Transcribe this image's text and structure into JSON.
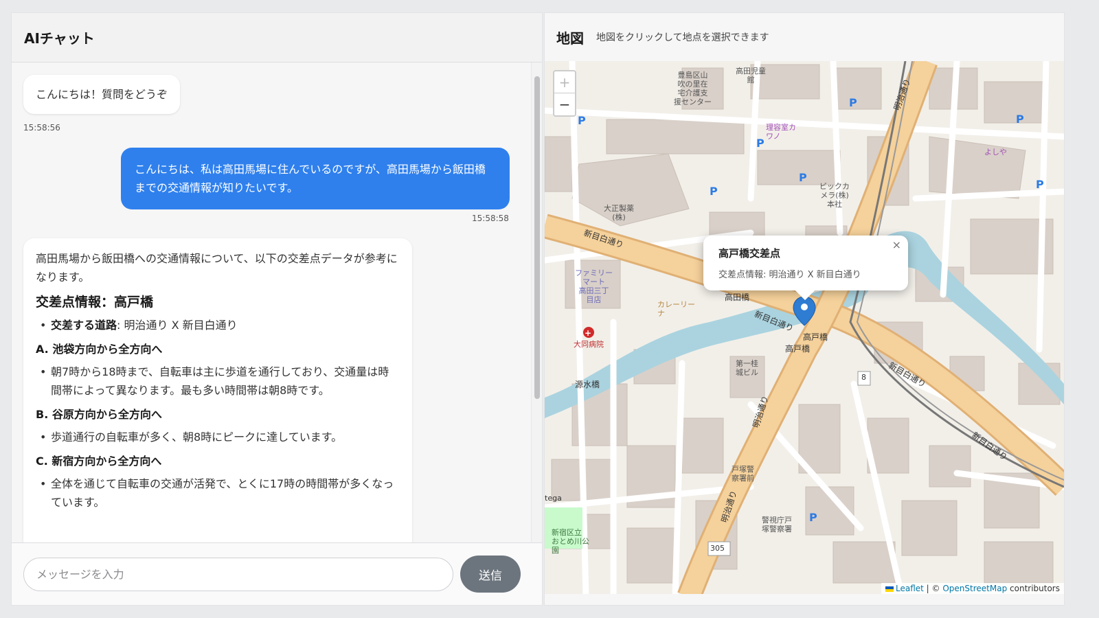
{
  "chat": {
    "title": "AIチャット",
    "messages": [
      {
        "role": "ai",
        "text": "こんにちは！質問をどうぞ",
        "time": "15:58:56"
      },
      {
        "role": "user",
        "text": "こんにちは、私は高田馬場に住んでいるのですが、高田馬場から飯田橋までの交通情報が知りたいです。",
        "time": "15:58:58"
      },
      {
        "role": "ai",
        "intro": "高田馬場から飯田橋への交通情報について、以下の交差点データが参考になります。",
        "heading": "交差点情報：高戸橋",
        "road_label": "交差する道路",
        "road_value": ": 明治通り X 新目白通り",
        "sections": [
          {
            "title": "A. 池袋方向から全方向へ",
            "text": "朝7時から18時まで、自転車は主に歩道を通行しており、交通量は時間帯によって異なります。最も多い時間帯は朝8時です。"
          },
          {
            "title": "B. 谷原方向から全方向へ",
            "text": "歩道通行の自転車が多く、朝8時にピークに達しています。"
          },
          {
            "title": "C. 新宿方向から全方向へ",
            "text": "全体を通じて自転車の交通が活発で、とくに17時の時間帯が多くなっています。"
          }
        ]
      }
    ],
    "input_placeholder": "メッセージを入力",
    "send_label": "送信"
  },
  "map": {
    "title": "地図",
    "hint": "地図をクリックして地点を選択できます",
    "zoom_in": "+",
    "zoom_out": "−",
    "popup": {
      "title": "高戸橋交差点",
      "body": "交差点情報: 明治通り X 新目白通り",
      "close": "×"
    },
    "attribution": {
      "leaflet": "Leaflet",
      "sep": " | © ",
      "osm": "OpenStreetMap",
      "contrib": " contributors"
    },
    "labels": {
      "toshima": "豊島区山\n吹の里在\n宅介護支\n援センター",
      "takada_jido": "高田児童\n館",
      "riyoshitsu": "理容室カ\nワノ",
      "yoshiya": "よしや",
      "taisho": "大正製薬\n(株)",
      "bic": "ビックカ\nメラ(株)\n本社",
      "familymart": "ファミリー\nマート\n高田三丁\n目店",
      "curry": "カレーリー\nナ",
      "daido": "大同病院",
      "dai1": "第一桂\n城ビル",
      "keisatsu": "警視庁戸\n塚警察署",
      "totsuka": "戸塚警\n察署前",
      "matsukawa": "新宿区立\nおとめ川公\n園",
      "gensui": "源水橋",
      "takadabashi": "高田橋",
      "takatobashi1": "高戸橋",
      "takatobashi2": "高戸橋",
      "tega": "tega",
      "n8": "8",
      "n305": "305",
      "shinmejiro1": "新目白通り",
      "shinmejiro2": "新目白通り",
      "shinmejiro3": "新目白通り",
      "shinmejiro4": "新目白通り",
      "meiji1": "明治通り",
      "meiji2": "明治通り",
      "meiji3": "明治通り"
    }
  }
}
